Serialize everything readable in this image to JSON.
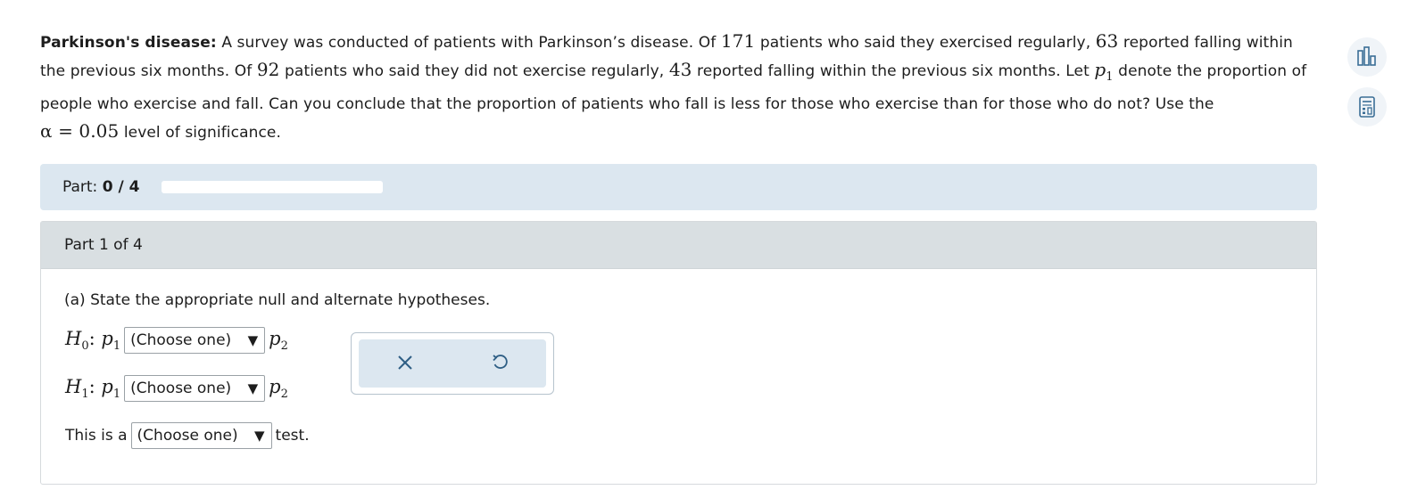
{
  "problem": {
    "title": "Parkinson's disease:",
    "text_1": "A survey was conducted of patients with Parkinson’s disease. Of",
    "n1": "171",
    "text_2": "patients who said they exercised regularly,",
    "x1": "63",
    "text_3": "reported falling within the previous six months. Of",
    "n2": "92",
    "text_4": "patients who said they did not exercise regularly,",
    "x2": "43",
    "text_5": "reported falling within the previous six months. Let",
    "p_symbol": "p",
    "p_sub": "1",
    "text_6": "denote the proportion of people who exercise and fall. Can you conclude that the proportion of patients who fall is less for those who exercise than for those who do not? Use the",
    "alpha_expr": "α = 0.05",
    "text_7": "level of significance."
  },
  "side_icons": [
    "bar-chart-icon",
    "calculator-icon"
  ],
  "part_bar": {
    "label": "Part:",
    "value": "0 / 4",
    "progress_fraction": 0
  },
  "part_card": {
    "heading": "Part 1 of 4",
    "question": "(a) State the appropriate null and alternate hypotheses.",
    "h0": {
      "H": "H",
      "sub": "0",
      "colon": ":",
      "p_left": "p",
      "p_left_sub": "1",
      "select": "(Choose one)",
      "p_right": "p",
      "p_right_sub": "2"
    },
    "h1": {
      "H": "H",
      "sub": "1",
      "colon": ":",
      "p_left": "p",
      "p_left_sub": "1",
      "select": "(Choose one)",
      "p_right": "p",
      "p_right_sub": "2"
    },
    "test_row": {
      "prefix": "This is a",
      "select": "(Choose one)",
      "suffix": "test."
    },
    "dropdown_arrow": "▼"
  },
  "tools": {
    "clear_icon": "close-icon",
    "undo_icon": "undo-icon"
  }
}
